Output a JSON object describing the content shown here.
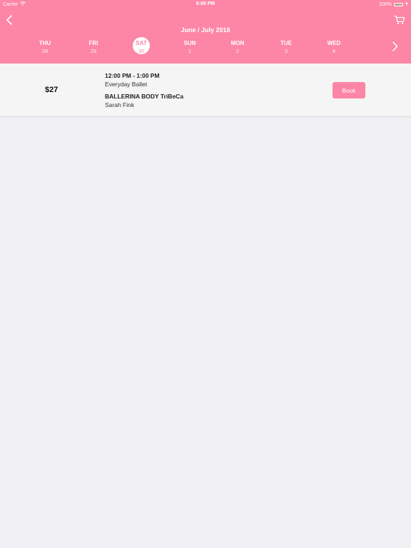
{
  "status_bar": {
    "carrier": "Carrier",
    "time": "6:08 PM",
    "battery": "100%"
  },
  "header": {
    "month_label": "June / July 2018",
    "back_icon": "chevron-left-icon",
    "cart_icon": "cart-icon",
    "next_icon": "chevron-right-icon"
  },
  "days": [
    {
      "name": "THU",
      "num": "28",
      "selected": false
    },
    {
      "name": "FRI",
      "num": "29",
      "selected": false
    },
    {
      "name": "SAT",
      "num": "30",
      "selected": true
    },
    {
      "name": "SUN",
      "num": "1",
      "selected": false
    },
    {
      "name": "MON",
      "num": "2",
      "selected": false
    },
    {
      "name": "TUE",
      "num": "3",
      "selected": false
    },
    {
      "name": "WED",
      "num": "4",
      "selected": false
    }
  ],
  "classes": [
    {
      "price": "$27",
      "time": "12:00 PM - 1:00 PM",
      "name": "Everyday Ballet",
      "studio": "BALLERINA BODY TriBeCa",
      "instructor": "Sarah Fink",
      "book_label": "Book"
    }
  ],
  "colors": {
    "accent": "#fd85a5",
    "background": "#efeff4",
    "row_background": "#f5f5f5"
  }
}
